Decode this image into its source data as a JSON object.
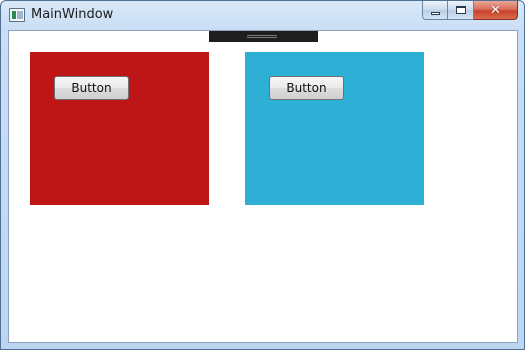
{
  "window": {
    "title": "MainWindow",
    "icon": "app-window-icon",
    "caption_buttons": {
      "minimize_icon": "minimize-icon",
      "maximize_icon": "maximize-icon",
      "close_icon": "close-icon",
      "close_glyph": "✕"
    }
  },
  "colors": {
    "panel_red": "#BE1616",
    "panel_blue": "#2EB0D6"
  },
  "panels": [
    {
      "button_label": "Button"
    },
    {
      "button_label": "Button"
    }
  ]
}
